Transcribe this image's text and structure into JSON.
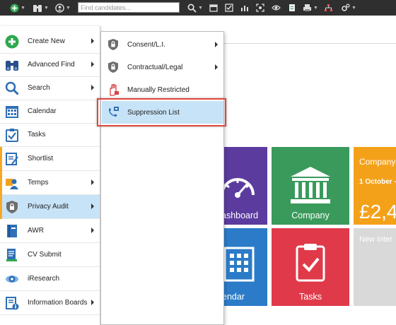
{
  "toolbar": {
    "search_placeholder": "Find candidates...",
    "icons": [
      "add-icon",
      "binoculars-icon",
      "user-icon",
      "search-icon",
      "calendar-icon",
      "tasks-icon",
      "chart-icon",
      "scan-icon",
      "eye-icon",
      "document-icon",
      "print-icon",
      "org-chart-icon",
      "settings-icon"
    ]
  },
  "menu": {
    "items": [
      {
        "label": "Create New",
        "icon": "add-icon",
        "submenu": true
      },
      {
        "label": "Advanced Find",
        "icon": "binoculars-icon",
        "submenu": true
      },
      {
        "label": "Search",
        "icon": "search-icon",
        "submenu": true
      },
      {
        "label": "Calendar",
        "icon": "calendar-icon",
        "submenu": false
      },
      {
        "label": "Tasks",
        "icon": "tasks-icon",
        "submenu": false
      },
      {
        "label": "Shortlist",
        "icon": "shortlist-icon",
        "submenu": false
      },
      {
        "label": "Temps",
        "icon": "temps-icon",
        "submenu": true
      },
      {
        "label": "Privacy Audit",
        "icon": "privacy-shield-icon",
        "submenu": true,
        "active": true
      },
      {
        "label": "AWR",
        "icon": "awr-book-icon",
        "submenu": true
      },
      {
        "label": "CV Submit",
        "icon": "cv-submit-icon",
        "submenu": false
      },
      {
        "label": "iResearch",
        "icon": "iresearch-icon",
        "submenu": false
      },
      {
        "label": "Information Boards",
        "icon": "information-boards-icon",
        "submenu": true
      }
    ]
  },
  "submenu": {
    "items": [
      {
        "label": "Consent/L.I.",
        "icon": "lock-shield-icon",
        "submenu": true
      },
      {
        "label": "Contractual/Legal",
        "icon": "lock-shield-icon",
        "submenu": true
      },
      {
        "label": "Manually Restricted",
        "icon": "restricted-hand-icon",
        "submenu": false
      },
      {
        "label": "Suppression List",
        "icon": "suppression-phone-icon",
        "submenu": false,
        "highlighted": true
      }
    ]
  },
  "tiles": {
    "dashboard": {
      "label": "ashboard",
      "color": "#5b3c9e"
    },
    "company": {
      "label": "Company",
      "color": "#3a9a5c"
    },
    "company_stats": {
      "title": "Company",
      "date": "1 October -",
      "amount": "£2,4",
      "color": "#f4a11a"
    },
    "calendar": {
      "label": "endar",
      "color": "#2b7bc9"
    },
    "tasks": {
      "label": "Tasks",
      "color": "#e03a4a"
    },
    "new_interview": {
      "label": "New Inter",
      "color": "#d9d9d9"
    }
  },
  "colors": {
    "accent_orange": "#f7a823",
    "highlight_red": "#e0483d",
    "selection_blue": "#c7e3f7"
  }
}
